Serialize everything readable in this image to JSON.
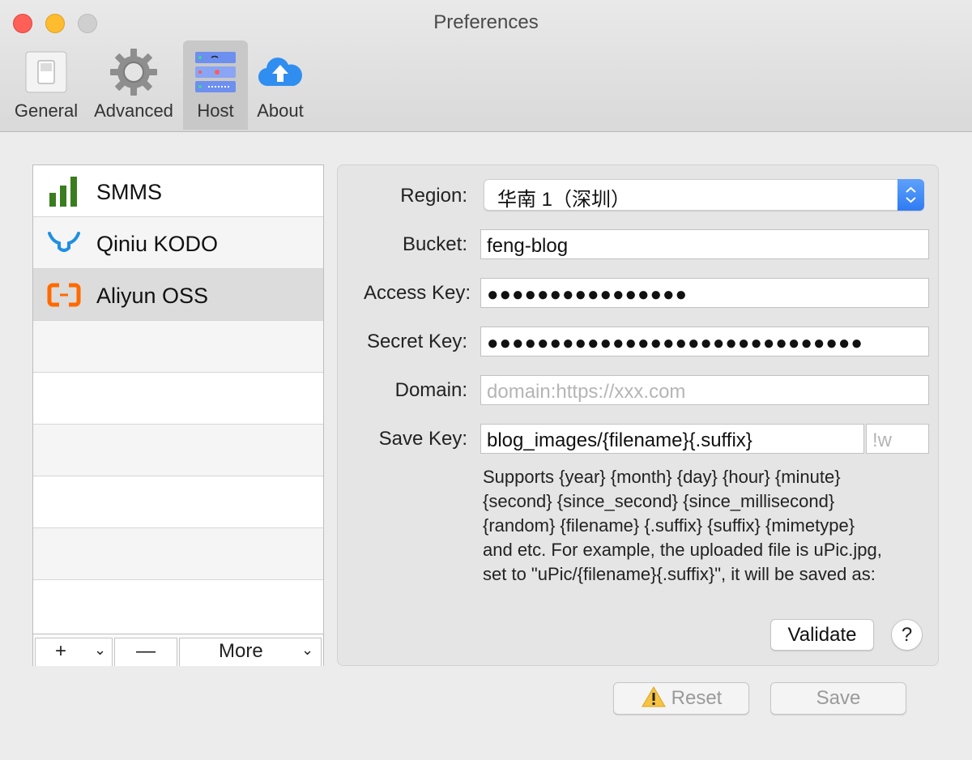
{
  "window": {
    "title": "Preferences"
  },
  "toolbar": {
    "items": [
      {
        "label": "General",
        "icon": "switch-icon"
      },
      {
        "label": "Advanced",
        "icon": "gear-icon"
      },
      {
        "label": "Host",
        "icon": "server-icon",
        "selected": true
      },
      {
        "label": "About",
        "icon": "cloud-upload-icon"
      }
    ]
  },
  "hosts": {
    "items": [
      {
        "label": "SMMS",
        "icon": "bars-icon"
      },
      {
        "label": "Qiniu KODO",
        "icon": "qiniu-icon"
      },
      {
        "label": "Aliyun OSS",
        "icon": "aliyun-icon",
        "selected": true
      }
    ],
    "buttons": {
      "add": "+",
      "remove": "—",
      "more": "More"
    }
  },
  "form": {
    "region": {
      "label": "Region:",
      "value": "华南 1（深圳）"
    },
    "bucket": {
      "label": "Bucket:",
      "value": "feng-blog"
    },
    "access_key": {
      "label": "Access Key:",
      "value": "●●●●●●●●●●●●●●●●"
    },
    "secret_key": {
      "label": "Secret Key:",
      "value": "●●●●●●●●●●●●●●●●●●●●●●●●●●●●●●"
    },
    "domain": {
      "label": "Domain:",
      "value": "",
      "placeholder": "domain:https://xxx.com"
    },
    "save_key": {
      "label": "Save Key:",
      "value": "blog_images/{filename}{.suffix}",
      "suffix_placeholder": "!w"
    },
    "help_lines": [
      "Supports {year} {month} {day} {hour} {minute}",
      "{second} {since_second} {since_millisecond}",
      "{random} {filename} {.suffix} {suffix} {mimetype}",
      "and etc. For example, the uploaded file is uPic.jpg,",
      "set to \"uPic/{filename}{.suffix}\", it will be saved as:"
    ],
    "validate_label": "Validate",
    "help_label": "?"
  },
  "footer": {
    "reset_label": "Reset",
    "save_label": "Save"
  },
  "colors": {
    "accent": "#2f7bf2",
    "smms_green": "#3a7d1e",
    "qiniu_blue": "#1f8fe0",
    "aliyun_orange": "#ff6a00"
  }
}
